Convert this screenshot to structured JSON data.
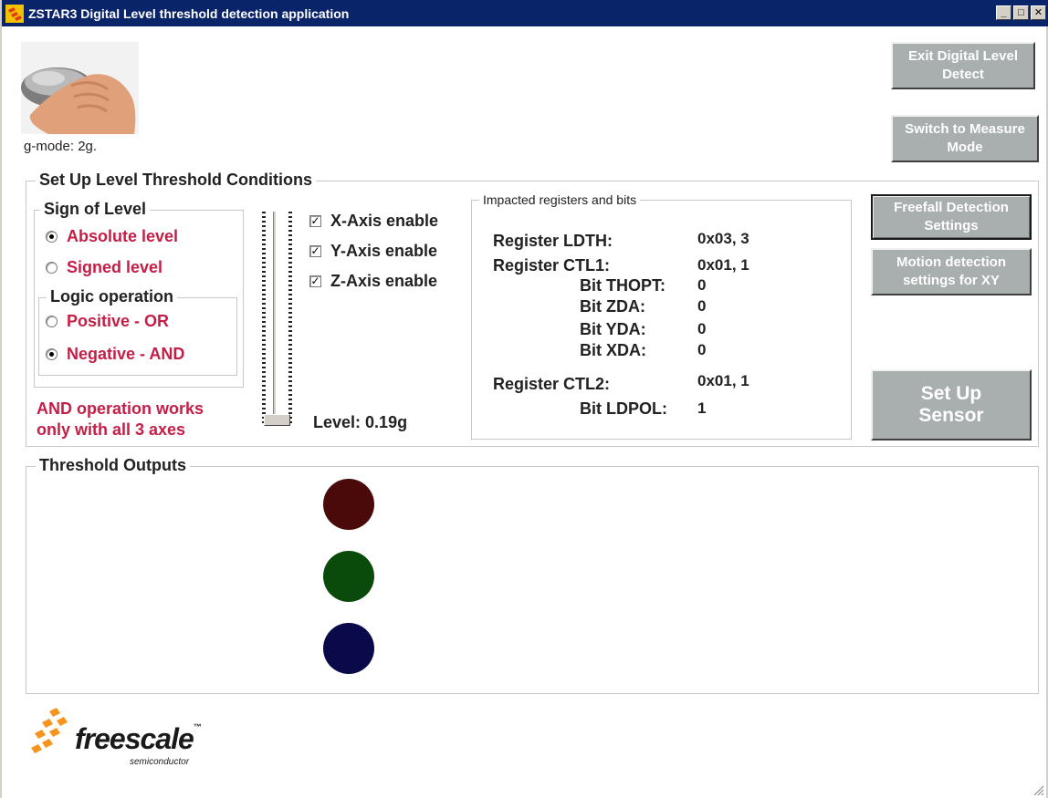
{
  "window": {
    "title": "ZSTAR3 Digital Level threshold detection application",
    "controls": [
      "_",
      "□",
      "✕"
    ]
  },
  "gmode": {
    "label": "g-mode:",
    "value": "2g."
  },
  "buttons": {
    "exit": "Exit Digital Level Detect",
    "switch_measure": "Switch to Measure Mode",
    "freefall": "Freefall Detection Settings",
    "motion": "Motion detection settings for XY",
    "setup": "Set Up Sensor"
  },
  "setup_group": {
    "title": "Set Up Level Threshold Conditions",
    "sign_group": {
      "title": "Sign of Level",
      "options": [
        {
          "label": "Absolute level",
          "selected": true
        },
        {
          "label": "Signed level",
          "selected": false
        }
      ]
    },
    "logic_group": {
      "title": "Logic operation",
      "options": [
        {
          "label": "Positive - OR",
          "selected": false
        },
        {
          "label": "Negative - AND",
          "selected": true
        }
      ]
    },
    "warning": [
      "AND operation works",
      "only with all 3 axes"
    ],
    "axes": [
      {
        "label": "X-Axis enable",
        "checked": true
      },
      {
        "label": "Y-Axis enable",
        "checked": true
      },
      {
        "label": "Z-Axis enable",
        "checked": true
      }
    ],
    "level": {
      "label": "Level:",
      "value": "0.19g",
      "slider_fraction": 0.0
    }
  },
  "registers": {
    "title": "Impacted registers and bits",
    "rows": [
      {
        "name": "Register LDTH:",
        "value": "0x03, 3"
      },
      {
        "name": "Register CTL1:",
        "value": "0x01, 1"
      },
      {
        "name": "Bit THOPT:",
        "value": "0"
      },
      {
        "name": "Bit ZDA:",
        "value": "0"
      },
      {
        "name": "Bit YDA:",
        "value": "0"
      },
      {
        "name": "Bit XDA:",
        "value": "0"
      },
      {
        "name": "Register CTL2:",
        "value": "0x01, 1"
      },
      {
        "name": "Bit LDPOL:",
        "value": "1"
      }
    ]
  },
  "outputs": {
    "title": "Threshold Outputs",
    "leds": [
      {
        "name": "x-output",
        "color": "#4a0a0a"
      },
      {
        "name": "y-output",
        "color": "#0a4a0a"
      },
      {
        "name": "z-output",
        "color": "#0a0a4a"
      }
    ]
  },
  "logo": {
    "brand": "freescale",
    "tm": "™",
    "sub": "semiconductor"
  },
  "colors": {
    "title_bar": "#0a246a",
    "option_text": "#c41e47",
    "button_face": "#a9aeae"
  }
}
